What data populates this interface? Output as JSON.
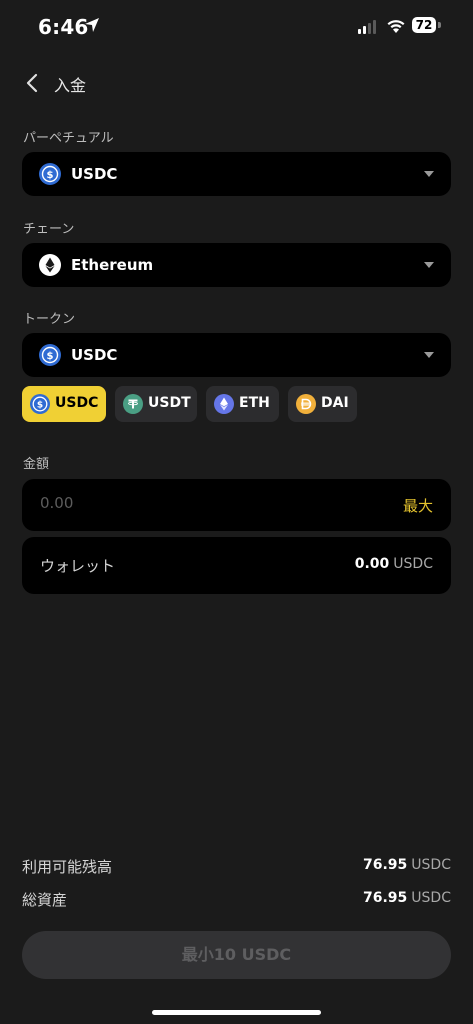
{
  "status_bar": {
    "time": "6:46",
    "battery": "72"
  },
  "header": {
    "title": "入金"
  },
  "perpetual": {
    "label": "パーペチュアル",
    "value": "USDC",
    "icon": "usdc-coin-icon"
  },
  "chain": {
    "label": "チェーン",
    "value": "Ethereum",
    "icon": "ethereum-icon"
  },
  "token": {
    "label": "トークン",
    "value": "USDC",
    "icon": "usdc-coin-icon",
    "options": [
      {
        "label": "USDC",
        "icon": "usdc-coin-icon",
        "selected": true
      },
      {
        "label": "USDT",
        "icon": "tether-icon",
        "selected": false
      },
      {
        "label": "ETH",
        "icon": "ethereum-icon",
        "selected": false
      },
      {
        "label": "DAI",
        "icon": "dai-icon",
        "selected": false
      }
    ]
  },
  "amount": {
    "label": "金額",
    "placeholder": "0.00",
    "max_label": "最大"
  },
  "wallet": {
    "label": "ウォレット",
    "value": "0.00",
    "unit": "USDC"
  },
  "summary": {
    "available": {
      "label": "利用可能残高",
      "value": "76.95",
      "unit": "USDC"
    },
    "total": {
      "label": "総資産",
      "value": "76.95",
      "unit": "USDC"
    }
  },
  "submit": {
    "label": "最小10 USDC"
  },
  "colors": {
    "accent": "#f0d034",
    "background": "#1b1b1b",
    "field": "#000000",
    "chip": "#2c2c2e"
  }
}
